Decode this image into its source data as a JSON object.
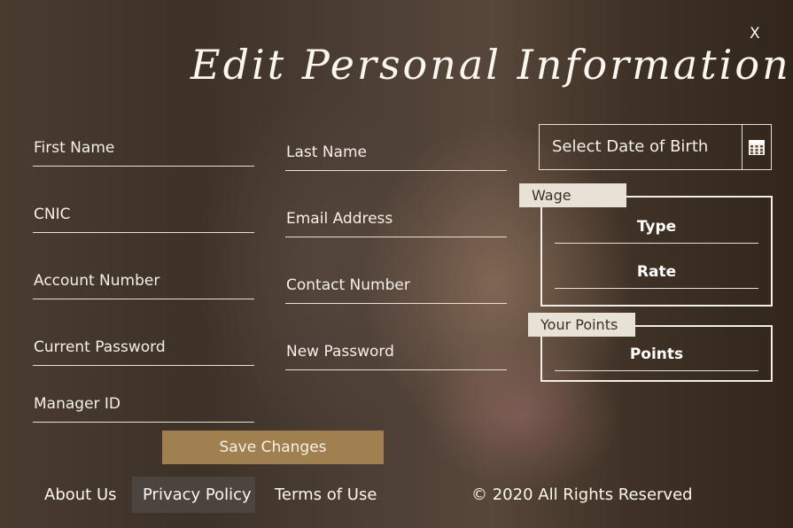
{
  "window": {
    "close_label": "X",
    "title": "Edit Personal Information"
  },
  "form": {
    "left_column": [
      {
        "label": "First Name"
      },
      {
        "label": "CNIC"
      },
      {
        "label": "Account Number"
      },
      {
        "label": "Current Password"
      },
      {
        "label": "Manager ID"
      }
    ],
    "middle_column": [
      {
        "label": "Last Name"
      },
      {
        "label": "Email Address"
      },
      {
        "label": "Contact Number"
      },
      {
        "label": "New Password"
      }
    ],
    "date_of_birth": {
      "label": "Select Date of Birth",
      "icon": "calendar-icon"
    },
    "wage_panel": {
      "tab_label": "Wage",
      "fields": [
        {
          "label": "Type"
        },
        {
          "label": "Rate"
        }
      ]
    },
    "points_panel": {
      "tab_label": "Your Points",
      "fields": [
        {
          "label": "Points"
        }
      ]
    },
    "save_label": "Save Changes"
  },
  "footer": {
    "links": [
      {
        "label": "About Us"
      },
      {
        "label": "Privacy Policy"
      },
      {
        "label": "Terms of Use"
      }
    ],
    "copyright": "© 2020 All Rights Reserved"
  },
  "colors": {
    "save_button": "#a08050",
    "tab_background": "#e8e1d6",
    "border": "#f2ede6"
  }
}
